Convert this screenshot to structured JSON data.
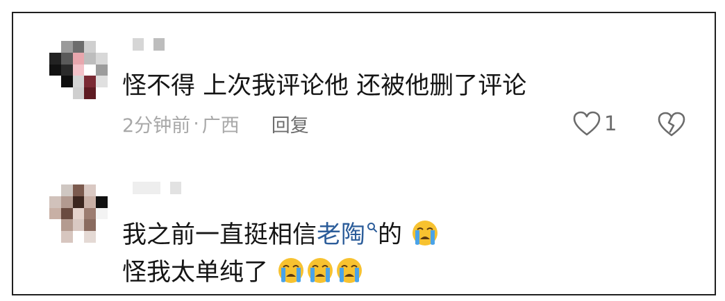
{
  "comments": [
    {
      "text": "怪不得 上次我评论他 还被他删了评论",
      "time": "2分钟前",
      "separator": "·",
      "location": "广西",
      "reply_label": "回复",
      "like_count": "1"
    },
    {
      "text_before_link": "我之前一直挺相信",
      "link_text": "老陶",
      "text_after_link": "的",
      "line2_text": "怪我太单纯了",
      "emoji": "crying-face"
    }
  ],
  "colors": {
    "text": "#151515",
    "meta": "#a8a8a8",
    "reply": "#6e6e6e",
    "link": "#2c5d9a",
    "emoji_face": "#f7c230",
    "emoji_tears": "#4aa3e8"
  }
}
